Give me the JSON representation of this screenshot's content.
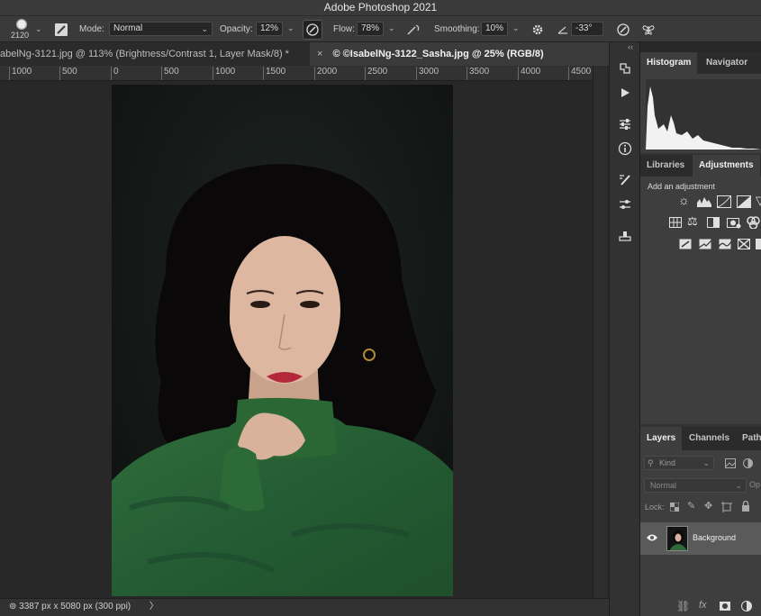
{
  "app": {
    "title": "Adobe Photoshop 2021"
  },
  "options": {
    "brush_size": "2120",
    "mode_label": "Mode:",
    "mode_value": "Normal",
    "opacity_label": "Opacity:",
    "opacity_value": "12%",
    "flow_label": "Flow:",
    "flow_value": "78%",
    "smoothing_label": "Smoothing:",
    "smoothing_value": "10%",
    "angle_value": "-33°"
  },
  "tabs": [
    {
      "label": "abelNg-3121.jpg @ 113% (Brightness/Contrast 1, Layer Mask/8) *"
    },
    {
      "close": "×",
      "label": "© ©IsabelNg-3122_Sasha.jpg @ 25% (RGB/8)"
    }
  ],
  "ruler": {
    "ticks": [
      "1000",
      "500",
      "0",
      "500",
      "1000",
      "1500",
      "2000",
      "2500",
      "3000",
      "3500",
      "4000",
      "4500"
    ]
  },
  "status": {
    "dimensions": "⊚ 3387 px x 5080 px (300 ppi)",
    "arrow": "〉"
  },
  "panels": {
    "collapse": "‹‹",
    "histogram_tab": "Histogram",
    "navigator_tab": "Navigator",
    "libraries_tab": "Libraries",
    "adjustments_tab": "Adjustments",
    "add_adjustment": "Add an adjustment",
    "layers_tab": "Layers",
    "channels_tab": "Channels",
    "paths_tab": "Path",
    "kind_filter": "Kind",
    "blend_mode": "Normal",
    "opacity_short": "Op",
    "lock_label": "Lock:",
    "layer_name": "Background"
  },
  "colors": {
    "ui_bg": "#282828",
    "panel_bg": "#323232",
    "sweater_green": "#2c6b38",
    "backdrop": "#161b19"
  }
}
